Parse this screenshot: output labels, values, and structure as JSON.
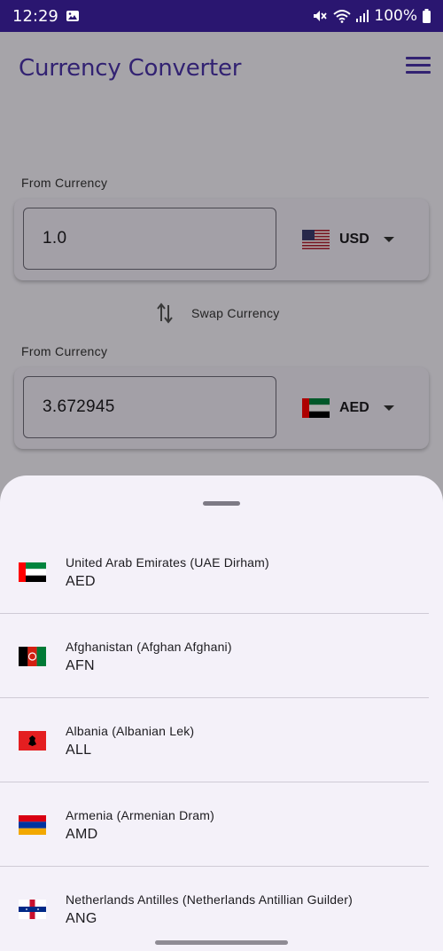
{
  "status_bar": {
    "time": "12:29",
    "battery": "100%"
  },
  "app_bar": {
    "title": "Currency Converter",
    "menu_icon": "hamburger-menu-icon"
  },
  "from": {
    "label": "From Currency",
    "amount": "1.0",
    "currency_code": "USD",
    "flag": "us-flag-icon"
  },
  "swap": {
    "label": "Swap Currency",
    "icon": "swap-vertical-icon"
  },
  "to": {
    "label": "From Currency",
    "amount": "3.672945",
    "currency_code": "AED",
    "flag": "uae-flag-icon"
  },
  "currency_list": {
    "items": [
      {
        "name": "United Arab Emirates (UAE Dirham)",
        "code": "AED",
        "flag": "uae-flag-icon"
      },
      {
        "name": "Afghanistan (Afghan Afghani)",
        "code": "AFN",
        "flag": "afghanistan-flag-icon"
      },
      {
        "name": "Albania (Albanian Lek)",
        "code": "ALL",
        "flag": "albania-flag-icon"
      },
      {
        "name": "Armenia (Armenian Dram)",
        "code": "AMD",
        "flag": "armenia-flag-icon"
      },
      {
        "name": "Netherlands Antilles (Netherlands Antillian Guilder)",
        "code": "ANG",
        "flag": "netherlands-antilles-flag-icon"
      }
    ]
  },
  "colors": {
    "status_bar": "#2a1670",
    "accent": "#4a33a8",
    "sheet": "#f4f1f9"
  }
}
